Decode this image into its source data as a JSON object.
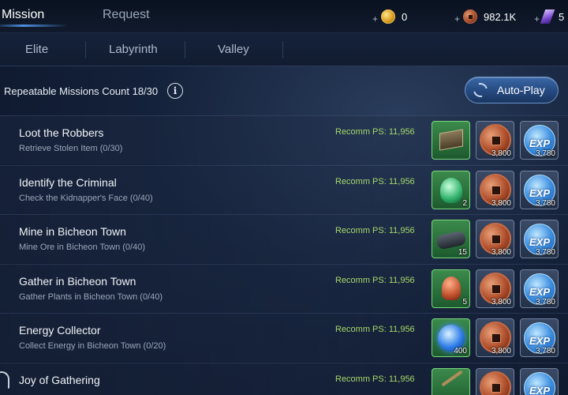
{
  "header": {
    "tabs": [
      {
        "label": "Mission",
        "active": true
      },
      {
        "label": "Request",
        "active": false
      }
    ],
    "currencies": [
      {
        "icon": "gold-coin-icon",
        "value": "0"
      },
      {
        "icon": "copper-coin-icon",
        "value": "982.1K"
      },
      {
        "icon": "crystal-icon",
        "value": "5"
      }
    ],
    "plus": "+"
  },
  "subtabs": [
    "Elite",
    "Labyrinth",
    "Valley"
  ],
  "count_label": "Repeatable Missions Count 18/30",
  "info_glyph": "i",
  "autoplay_label": "Auto-Play",
  "exp_label": "EXP",
  "missions": [
    {
      "title": "Loot the Robbers",
      "sub": "Retrieve Stolen Item (0/30)",
      "recomm": "Recomm PS: 11,956",
      "item": "chest-icon",
      "item_qty": "",
      "coin_qty": "3,800",
      "exp_qty": "3,780"
    },
    {
      "title": "Identify the Criminal",
      "sub": "Check the Kidnapper's Face (0/40)",
      "recomm": "Recomm PS: 11,956",
      "item": "creature-icon",
      "item_qty": "2",
      "coin_qty": "3,800",
      "exp_qty": "3,780"
    },
    {
      "title": "Mine in Bicheon Town",
      "sub": "Mine Ore in Bicheon Town (0/40)",
      "recomm": "Recomm PS: 11,956",
      "item": "ore-icon",
      "item_qty": "15",
      "coin_qty": "3,800",
      "exp_qty": "3,780"
    },
    {
      "title": "Gather in Bicheon Town",
      "sub": "Gather Plants in Bicheon Town (0/40)",
      "recomm": "Recomm PS: 11,956",
      "item": "plant-icon",
      "item_qty": "5",
      "coin_qty": "3,800",
      "exp_qty": "3,780"
    },
    {
      "title": "Energy Collector",
      "sub": "Collect Energy in Bicheon Town (0/20)",
      "recomm": "Recomm PS: 11,956",
      "item": "energy-orb-icon",
      "item_qty": "400",
      "coin_qty": "3,800",
      "exp_qty": "3,780"
    },
    {
      "title": "Joy of Gathering",
      "sub": "",
      "recomm": "Recomm PS: 11,956",
      "item": "branch-icon",
      "item_qty": "",
      "coin_qty": "",
      "exp_qty": ""
    }
  ]
}
